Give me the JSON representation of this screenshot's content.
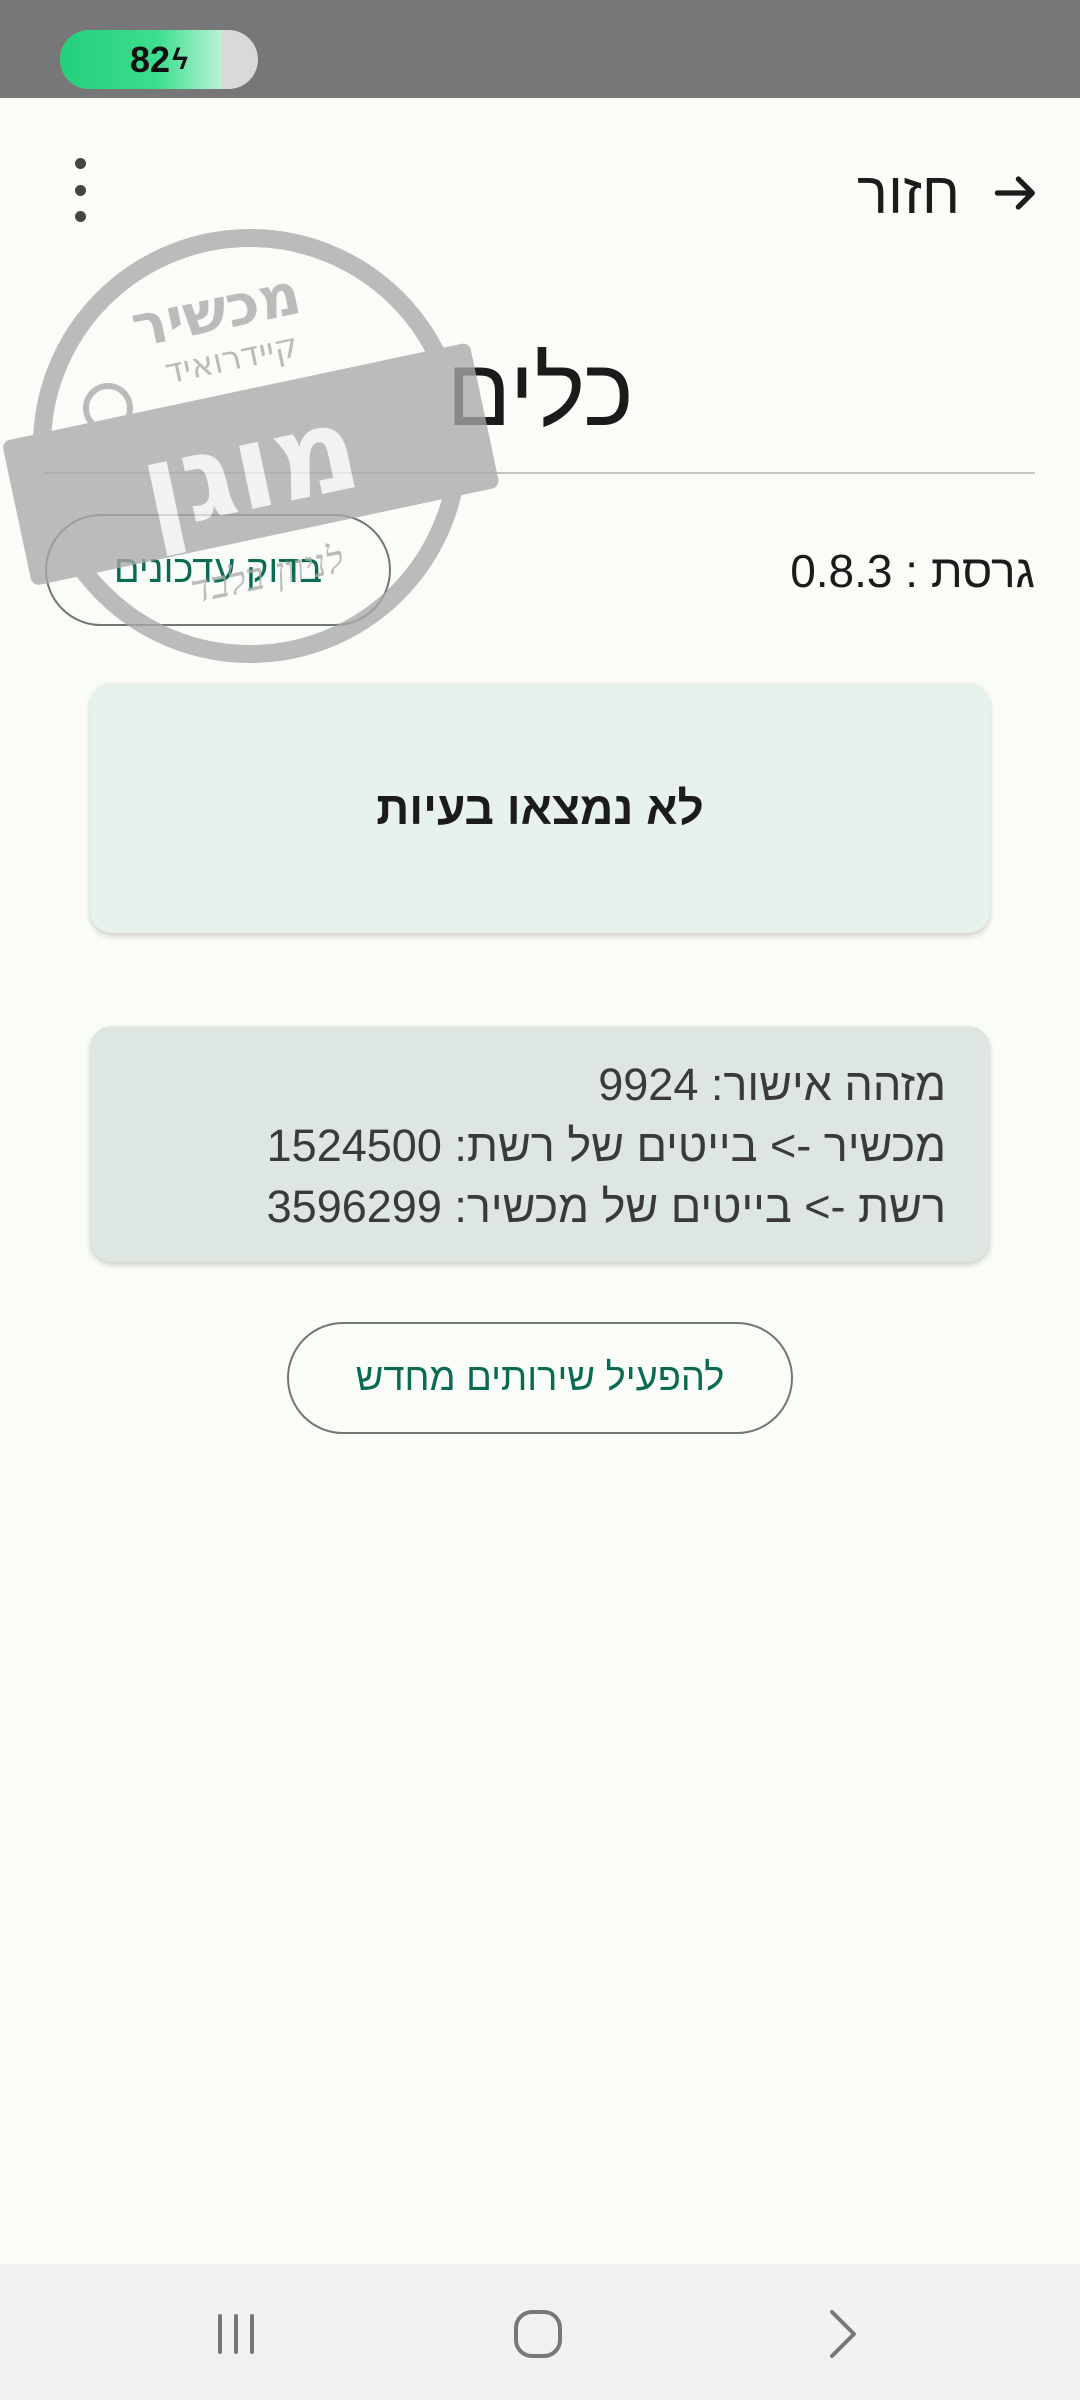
{
  "status_bar": {
    "battery_level": "82",
    "battery_fraction": 0.82,
    "charging_icon": "bolt-icon"
  },
  "header": {
    "back_label": "חזור",
    "back_icon": "arrow-right-icon",
    "menu_icon": "more-vertical-icon"
  },
  "page": {
    "title": "כלים",
    "version_label": "גרסת : 0.8.3",
    "check_updates_label": "בדוק עדכונים"
  },
  "status_card": {
    "text": "לא נמצאו בעיות"
  },
  "stats_card": {
    "lines": [
      "מזהה אישור: 9924",
      "מכשיר -> בייטים של רשת: 1524500",
      "רשת -> בייטים של מכשיר: 3596299"
    ]
  },
  "actions": {
    "restart_services_label": "להפעיל שירותים מחדש"
  },
  "watermark": {
    "line1": "מכשיר",
    "line2": "קיידרואיד",
    "stamp": "מוגן",
    "line3": "לניוון בלבד"
  },
  "nav_bar": {
    "recents_icon": "recents-icon",
    "home_icon": "home-icon",
    "back_icon": "back-chevron-icon"
  },
  "colors": {
    "accent": "#0a6a52",
    "background": "#fafcf7",
    "status_card_bg": "#e8f2ec",
    "stats_card_bg": "#dde6e1"
  }
}
